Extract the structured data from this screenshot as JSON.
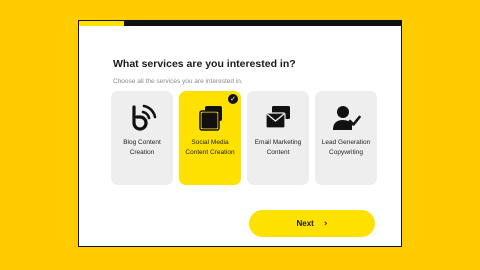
{
  "form": {
    "title": "What services are you interested in?",
    "subtitle": "Choose all the services you are interested in.",
    "progress": 0.14,
    "options": [
      {
        "label": "Blog Content Creation",
        "icon": "blog-icon",
        "selected": false
      },
      {
        "label": "Social Media Content Creation",
        "icon": "social-media-icon",
        "selected": true
      },
      {
        "label": "Email Marketing Content",
        "icon": "email-marketing-icon",
        "selected": false
      },
      {
        "label": "Lead Generation Copywriting",
        "icon": "lead-generation-icon",
        "selected": false
      }
    ],
    "next_label": "Next",
    "next_icon": "chevron-right-icon",
    "selected_icon": "checkmark-icon"
  },
  "colors": {
    "background": "#FFCC00",
    "accent": "#FFE100",
    "option_bg": "#EEEEEE",
    "text": "#1a1a1a"
  }
}
